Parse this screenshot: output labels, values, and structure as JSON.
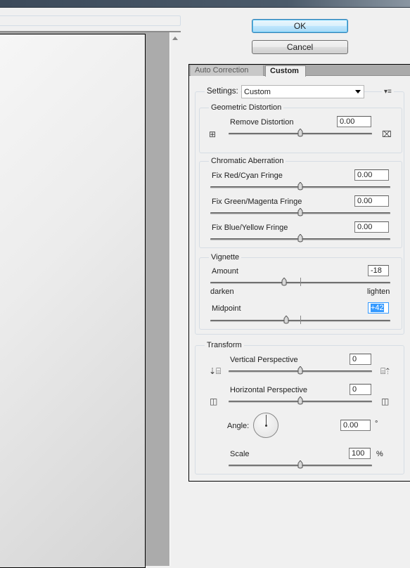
{
  "buttons": {
    "ok": "OK",
    "cancel": "Cancel"
  },
  "tabs": [
    {
      "label": "Auto Correction",
      "active": false
    },
    {
      "label": "Custom",
      "active": true
    }
  ],
  "settings": {
    "label": "Settings:",
    "value": "Custom",
    "menu_icon": "panel-menu-icon"
  },
  "geometric": {
    "title": "Geometric Distortion",
    "remove_label": "Remove Distortion",
    "remove_value": "0.00",
    "slider": 0,
    "left_icon": "pincushion-icon",
    "right_icon": "barrel-icon"
  },
  "chromatic": {
    "title": "Chromatic Aberration",
    "items": [
      {
        "label": "Fix Red/Cyan Fringe",
        "value": "0.00",
        "slider": 0
      },
      {
        "label": "Fix Green/Magenta Fringe",
        "value": "0.00",
        "slider": 0
      },
      {
        "label": "Fix Blue/Yellow Fringe",
        "value": "0.00",
        "slider": 0
      }
    ]
  },
  "vignette": {
    "title": "Vignette",
    "amount_label": "Amount",
    "amount_value": "-18",
    "amount": -18,
    "darken": "darken",
    "lighten": "lighten",
    "midpoint_label": "Midpoint",
    "midpoint_value": "+42",
    "midpoint": 42
  },
  "transform": {
    "title": "Transform",
    "vertical_label": "Vertical Perspective",
    "vertical_value": "0",
    "vertical": 0,
    "horizontal_label": "Horizontal Perspective",
    "horizontal_value": "0",
    "horizontal": 0,
    "angle_label": "Angle:",
    "angle_value": "0.00",
    "angle_unit": "°",
    "angle": 0,
    "scale_label": "Scale",
    "scale_value": "100",
    "scale_unit": "%",
    "scale": 100
  }
}
